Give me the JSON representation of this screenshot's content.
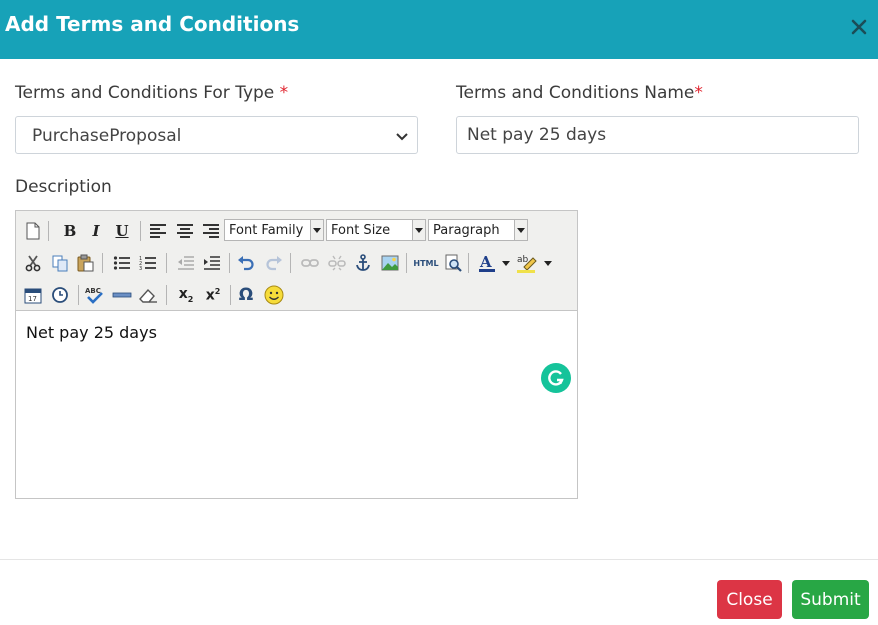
{
  "modal": {
    "title": "Add Terms and Conditions"
  },
  "form": {
    "type_label": "Terms and Conditions For Type",
    "type_required_marker": "*",
    "type_selected": "PurchaseProposal",
    "name_label": "Terms and Conditions Name",
    "name_required_marker": "*",
    "name_value": "Net pay 25 days",
    "description_label": "Description"
  },
  "editor": {
    "dropdowns": {
      "font_family": "Font Family",
      "font_size": "Font Size",
      "format": "Paragraph"
    },
    "content": "Net pay 25 days",
    "icons": [
      "new-document-icon",
      "bold-icon",
      "italic-icon",
      "underline-icon",
      "align-left-icon",
      "align-center-icon",
      "align-right-icon",
      "cut-icon",
      "copy-icon",
      "paste-icon",
      "bullet-list-icon",
      "numbered-list-icon",
      "outdent-icon",
      "indent-icon",
      "undo-icon",
      "redo-icon",
      "link-icon",
      "unlink-icon",
      "anchor-icon",
      "image-icon",
      "html-icon",
      "preview-icon",
      "text-color-icon",
      "highlight-color-icon",
      "insert-date-icon",
      "insert-time-icon",
      "spellcheck-icon",
      "horizontal-rule-icon",
      "clear-formatting-icon",
      "subscript-icon",
      "superscript-icon",
      "special-character-icon",
      "emoticon-icon",
      "grammarly-icon"
    ],
    "labels": {
      "bold": "B",
      "italic": "I",
      "underline": "U",
      "html": "HTML",
      "subscript": "x",
      "subscript_mark": "2",
      "superscript": "x",
      "superscript_mark": "2",
      "omega": "Ω",
      "text_color": "A",
      "highlight": "ab",
      "spell": "ABC"
    }
  },
  "buttons": {
    "close": "Close",
    "submit": "Submit"
  },
  "colors": {
    "header": "#17a2b8",
    "close_button": "#dc3545",
    "submit_button": "#28a745",
    "required": "#e0232e",
    "grammarly": "#15c39a"
  }
}
